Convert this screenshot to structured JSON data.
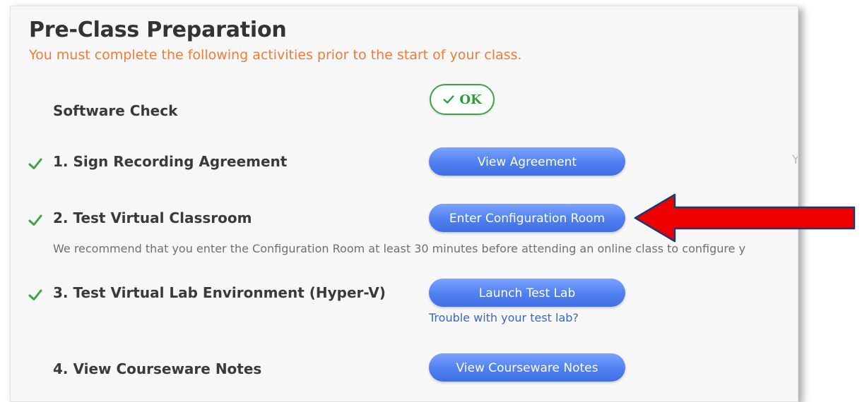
{
  "header": {
    "title": "Pre-Class Preparation",
    "subtitle": "You must complete the following activities prior to the start of your class."
  },
  "software_check": {
    "label": "Software Check",
    "status": "OK",
    "status_icon": "checkmark-icon",
    "status_color": "#2f9a3a"
  },
  "steps": [
    {
      "label": "1. Sign Recording Agreement",
      "completed": true,
      "button_label": "View Agreement"
    },
    {
      "label": "2. Test Virtual Classroom",
      "completed": true,
      "button_label": "Enter Configuration Room",
      "note": "We recommend that you enter the Configuration Room at least 30 minutes before attending an online class to configure y"
    },
    {
      "label": "3. Test Virtual Lab Environment (Hyper-V)",
      "completed": true,
      "button_label": "Launch Test Lab",
      "help_link": "Trouble with your test lab?"
    },
    {
      "label": "4. View Courseware Notes",
      "completed": false,
      "button_label": "View Courseware Notes"
    }
  ],
  "stray_char": "Y",
  "colors": {
    "accent_orange": "#f07c3a",
    "button_blue": "#4f7ff0",
    "check_green": "#3aa646",
    "annotation_red": "#ee0000"
  },
  "annotation": {
    "icon": "red-arrow-icon"
  }
}
